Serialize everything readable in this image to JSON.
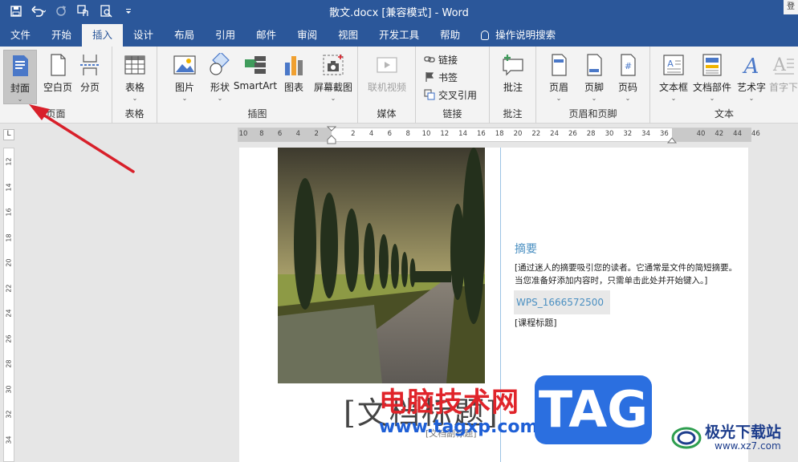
{
  "titlebar": {
    "title": "散文.docx [兼容模式] - Word",
    "qat_items": [
      "save-icon",
      "undo-icon",
      "redo-icon",
      "touch-mode-icon",
      "print-preview-icon",
      "customize-icon"
    ],
    "corner_label": "登"
  },
  "tabs": [
    {
      "label": "文件",
      "active": false
    },
    {
      "label": "开始",
      "active": false
    },
    {
      "label": "插入",
      "active": true
    },
    {
      "label": "设计",
      "active": false
    },
    {
      "label": "布局",
      "active": false
    },
    {
      "label": "引用",
      "active": false
    },
    {
      "label": "邮件",
      "active": false
    },
    {
      "label": "审阅",
      "active": false
    },
    {
      "label": "视图",
      "active": false
    },
    {
      "label": "开发工具",
      "active": false
    },
    {
      "label": "帮助",
      "active": false
    },
    {
      "label": "操作说明搜索",
      "active": false
    }
  ],
  "ribbon": {
    "pages": {
      "label": "页面",
      "cover": "封面",
      "blank": "空白页",
      "break": "分页"
    },
    "tables": {
      "label": "表格",
      "table": "表格"
    },
    "illustrations": {
      "label": "插图",
      "picture": "图片",
      "shapes": "形状",
      "smartart": "SmartArt",
      "chart": "图表",
      "screenshot": "屏幕截图"
    },
    "media": {
      "label": "媒体",
      "online_video": "联机视频"
    },
    "links": {
      "label": "链接",
      "link": "链接",
      "bookmark": "书签",
      "cross_ref": "交叉引用"
    },
    "comments": {
      "label": "批注",
      "comment": "批注"
    },
    "header_footer": {
      "label": "页眉和页脚",
      "header": "页眉",
      "footer": "页脚",
      "page_number": "页码"
    },
    "text": {
      "label": "文本",
      "textbox": "文本框",
      "quick_parts": "文档部件",
      "wordart": "艺术字",
      "dropcap": "首字下"
    }
  },
  "ruler": {
    "corner": "L",
    "ticks": [
      "10",
      "8",
      "6",
      "4",
      "2",
      "",
      "2",
      "4",
      "6",
      "8",
      "10",
      "12",
      "14",
      "16",
      "18",
      "20",
      "22",
      "24",
      "26",
      "28",
      "30",
      "32",
      "34",
      "36",
      "",
      "40",
      "42",
      "44",
      "46"
    ],
    "vticks": [
      "12",
      "14",
      "16",
      "18",
      "20",
      "22",
      "24",
      "26",
      "28",
      "30",
      "32",
      "34"
    ]
  },
  "document": {
    "abstract_title": "摘要",
    "abstract_body": "[通过迷人的摘要吸引您的读者。它通常是文件的简短摘要。当您准备好添加内容时，只需单击此处并开始键入。]",
    "author": "WPS_1666572500",
    "course": "[课程标题]",
    "title_placeholder": "[文档标题]",
    "subtitle_placeholder": "[文档副标题]"
  },
  "watermarks": {
    "cn": "电脑技术网",
    "url": "www.tagxp.com",
    "tag": "TAG",
    "site": "极光下载站",
    "site_url": "www.xz7.com"
  },
  "colors": {
    "accent": "#2b579a",
    "selected_button": "#c5c5c5",
    "arrow": "#d8202a",
    "abstract_blue": "#4a8fc1"
  }
}
